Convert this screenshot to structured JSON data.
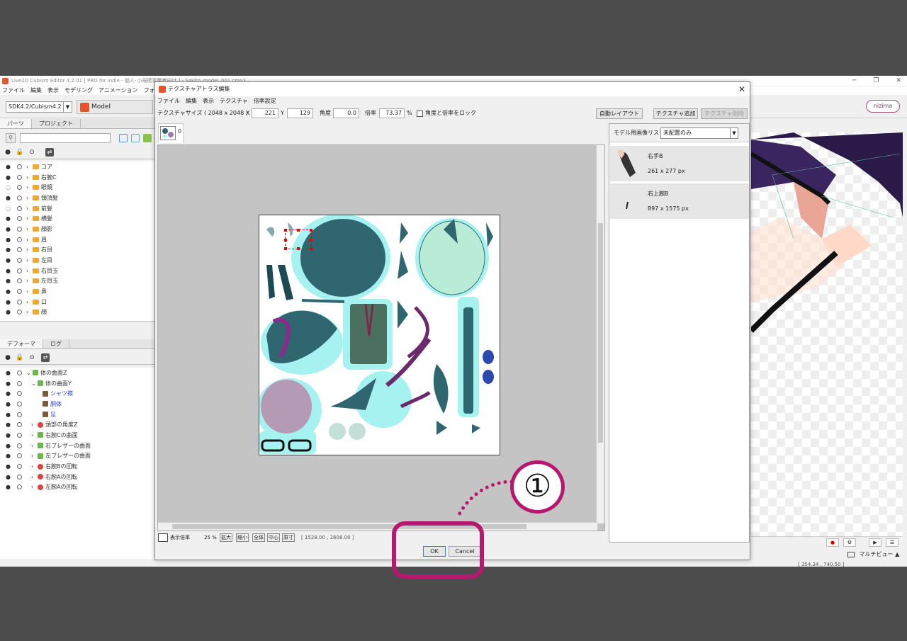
{
  "app": {
    "title": "Live2D Cubism Editor 4.2.01   [ PRO for indie - 個人･小規模事業者向け ] - Sakito_model_001.cmo3",
    "menu": [
      "ファイル",
      "編集",
      "表示",
      "モデリング",
      "アニメーション",
      "フォームアニメーション"
    ],
    "sdk_select": "SDK4.2/Cubism4.2",
    "mode_select": "Model",
    "nizima": "nizima"
  },
  "parts_panel": {
    "tabs": [
      "パーツ",
      "プロジェクト"
    ],
    "items": [
      {
        "label": "コア",
        "eye": true
      },
      {
        "label": "右腕C",
        "eye": true
      },
      {
        "label": "眼鏡",
        "eye": false
      },
      {
        "label": "頭頂髪",
        "eye": true
      },
      {
        "label": "前髪",
        "eye": false
      },
      {
        "label": "横髪",
        "eye": true
      },
      {
        "label": "顔影",
        "eye": true
      },
      {
        "label": "眉",
        "eye": true
      },
      {
        "label": "右目",
        "eye": true
      },
      {
        "label": "左目",
        "eye": true
      },
      {
        "label": "右目玉",
        "eye": true
      },
      {
        "label": "左目玉",
        "eye": true
      },
      {
        "label": "鼻",
        "eye": true
      },
      {
        "label": "口",
        "eye": true
      },
      {
        "label": "顔",
        "eye": true
      }
    ]
  },
  "deformer_panel": {
    "tabs": [
      "デフォーマ",
      "ログ"
    ],
    "items": [
      {
        "label": "体の曲面Z",
        "indent": 0,
        "type": "warp",
        "blue": false
      },
      {
        "label": "体の曲面Y",
        "indent": 1,
        "type": "warp",
        "blue": false
      },
      {
        "label": "シャツ襟",
        "indent": 2,
        "type": "art",
        "blue": true
      },
      {
        "label": "胴体",
        "indent": 2,
        "type": "art",
        "blue": true
      },
      {
        "label": "足",
        "indent": 2,
        "type": "art",
        "blue": true
      },
      {
        "label": "頭部の角度Z",
        "indent": 1,
        "type": "rot",
        "blue": false
      },
      {
        "label": "右腕Cの曲面",
        "indent": 1,
        "type": "warp",
        "blue": false
      },
      {
        "label": "右ブレザーの曲面",
        "indent": 1,
        "type": "warp",
        "blue": false
      },
      {
        "label": "左ブレザーの曲面",
        "indent": 1,
        "type": "warp",
        "blue": false
      },
      {
        "label": "右腕Bの回転",
        "indent": 1,
        "type": "rot",
        "blue": false
      },
      {
        "label": "右腕Aの回転",
        "indent": 1,
        "type": "rot",
        "blue": false
      },
      {
        "label": "左腕Aの回転",
        "indent": 1,
        "type": "rot",
        "blue": false
      }
    ]
  },
  "dialog": {
    "title": "テクスチャアトラス編集",
    "menu": [
      "ファイル",
      "編集",
      "表示",
      "テクスチャ",
      "倍率設定"
    ],
    "texture_size_label": "テクスチャサイズ ( 2048 x 2048 )",
    "x_label": "X",
    "x_value": "221",
    "y_label": "Y",
    "y_value": "129",
    "angle_label": "角度",
    "angle_value": "0.0",
    "scale_label": "倍率",
    "scale_value": "73.37",
    "percent": "%",
    "lock_label": "角度と倍率をロック",
    "auto_layout": "自動レイアウト",
    "add_texture": "テクスチャ追加",
    "delete_texture": "テクスチャ削除",
    "tab_index": "0",
    "zoom": {
      "label": "表示倍率",
      "value": "25 %",
      "buttons": [
        "拡大",
        "縮小",
        "全体",
        "中心",
        "原寸"
      ],
      "coords": "[ 1528.00 , 2608.00 ]"
    },
    "ok": "OK",
    "cancel": "Cancel"
  },
  "image_list": {
    "label": "モデル用画像リスト",
    "filter": "未配置のみ",
    "items": [
      {
        "name": "右手B",
        "size": "261 x 277 px"
      },
      {
        "name": "右上腕B",
        "size": "897 x 1575 px"
      }
    ]
  },
  "view": {
    "multi_view": "マルチビュー ▲",
    "coords": "[  354.34 ,  740.50 ]"
  },
  "annotation": {
    "step": "①"
  },
  "colors": {
    "accent": "#b8176f",
    "brand": "#e8542a",
    "texture_teal": "#2f6670",
    "mesh_cyan": "#a6f2f0"
  }
}
